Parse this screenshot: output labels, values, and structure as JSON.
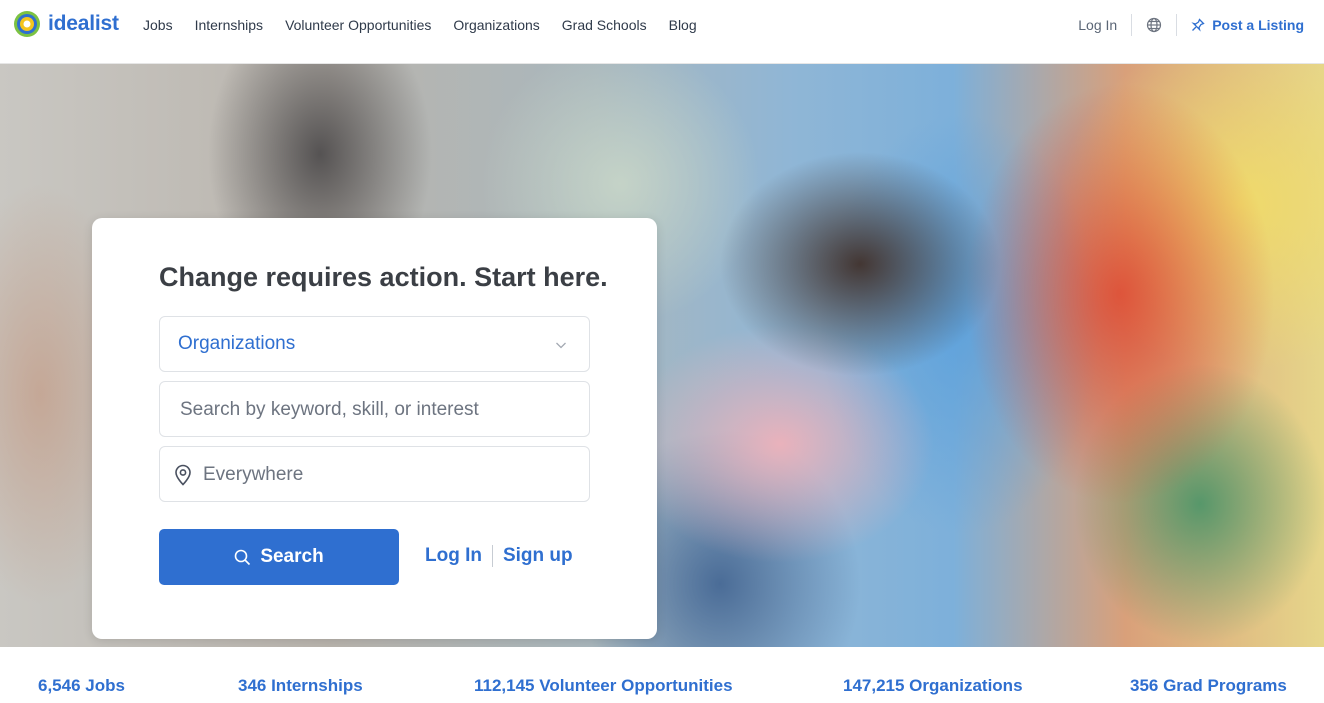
{
  "brand": {
    "name": "idealist",
    "logo_icon": "idealist-sun-logo",
    "accent_color": "#2f6fd0"
  },
  "nav": {
    "items": [
      {
        "label": "Jobs"
      },
      {
        "label": "Internships"
      },
      {
        "label": "Volunteer Opportunities"
      },
      {
        "label": "Organizations"
      },
      {
        "label": "Grad Schools"
      },
      {
        "label": "Blog"
      }
    ],
    "login_label": "Log In",
    "language_icon": "globe-icon",
    "post_listing_label": "Post a Listing",
    "post_listing_icon": "pin-icon"
  },
  "hero": {
    "headline": "Change requires action. Start here.",
    "listing_type": {
      "selected": "Organizations",
      "icon": "chevron-down-icon"
    },
    "keyword": {
      "placeholder": "Search by keyword, skill, or interest",
      "value": ""
    },
    "location": {
      "placeholder": "Everywhere",
      "value": "",
      "icon": "location-pin-icon"
    },
    "search_button": {
      "label": "Search",
      "icon": "search-icon"
    },
    "login_label": "Log In",
    "signup_label": "Sign up"
  },
  "stats": [
    {
      "label": "6,546 Jobs"
    },
    {
      "label": "346 Internships"
    },
    {
      "label": "112,145 Volunteer Opportunities"
    },
    {
      "label": "147,215 Organizations"
    },
    {
      "label": "356 Grad Programs"
    }
  ]
}
